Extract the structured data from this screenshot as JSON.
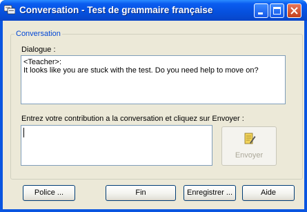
{
  "window": {
    "title": "Conversation - Test de grammaire française"
  },
  "group": {
    "legend": "Conversation"
  },
  "dialogue": {
    "label": "Dialogue :",
    "speaker": "<Teacher>:",
    "message": "It looks like you are stuck with the test. Do you need help to move on?"
  },
  "contribution": {
    "label": "Entrez votre contribution a la conversation et cliquez sur Envoyer :",
    "value": ""
  },
  "send": {
    "label": "Envoyer"
  },
  "buttons": {
    "font": "Police ...",
    "end": "Fin",
    "save": "Enregistrer ...",
    "help": "Aide"
  },
  "icons": {
    "app": "chat-icon",
    "minimize": "minimize-icon",
    "maximize": "maximize-icon",
    "close": "close-icon",
    "send": "notepad-pen-icon"
  },
  "colors": {
    "titlebar": "#0a5cf0",
    "close": "#c4401c",
    "legend": "#0046d5",
    "face": "#ece9d8"
  }
}
